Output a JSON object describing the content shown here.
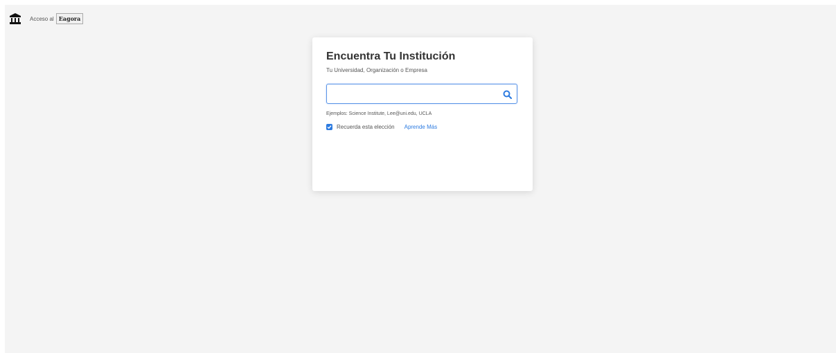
{
  "header": {
    "access_label": "Acceso al",
    "brand": "Eagora",
    "logo_icon": "institution-icon"
  },
  "card": {
    "title": "Encuentra Tu Institución",
    "subtitle": "Tu Universidad, Organización o Empresa",
    "search": {
      "value": "",
      "placeholder": "",
      "button_icon": "search-icon"
    },
    "examples": "Ejemplos: Science Institute, Lee@uni.edu, UCLA",
    "remember": {
      "label": "Recuerda esta elección",
      "checked": true
    },
    "learn_more": "Aprende Más"
  },
  "colors": {
    "accent": "#2d7be0",
    "background": "#f4f4f4",
    "card": "#ffffff"
  }
}
